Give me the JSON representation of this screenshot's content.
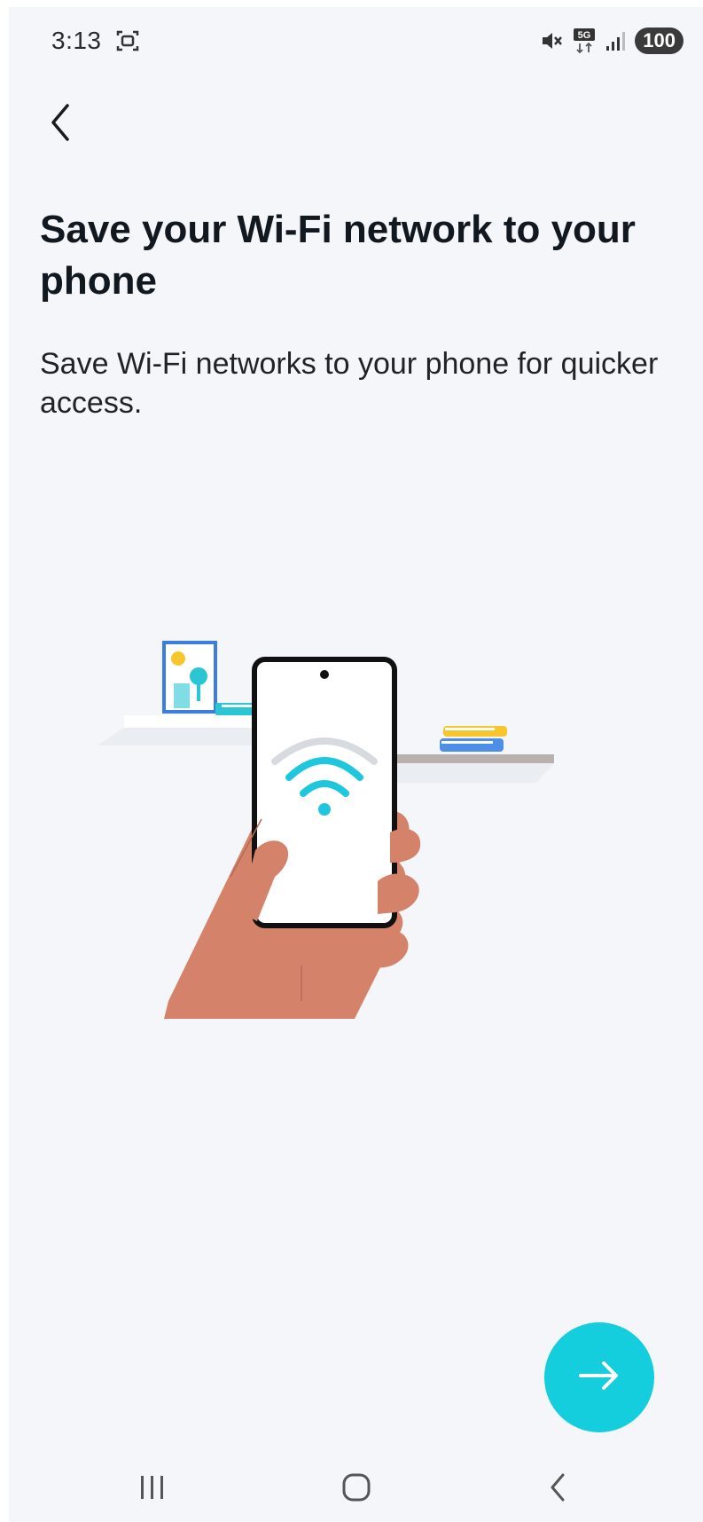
{
  "status_bar": {
    "time": "3:13",
    "battery": "100",
    "network": "5G",
    "icons": [
      "screenshot-icon",
      "mute-icon",
      "5g-icon",
      "signal-icon",
      "battery-icon"
    ]
  },
  "header": {
    "back_icon": "chevron-left-icon"
  },
  "main": {
    "title": "Save your Wi-Fi network to your phone",
    "subtitle": "Save Wi-Fi networks to your phone for quicker access.",
    "illustration": "hand-holding-phone-wifi-illustration"
  },
  "actions": {
    "next_icon": "arrow-right-icon"
  },
  "nav_bar": {
    "items": [
      "recent-apps-icon",
      "home-icon",
      "back-icon"
    ]
  },
  "colors": {
    "accent": "#14cddd",
    "background": "#f4f6f9",
    "text": "#111820",
    "skin": "#d4836a",
    "wifi": "#1ec7de"
  }
}
